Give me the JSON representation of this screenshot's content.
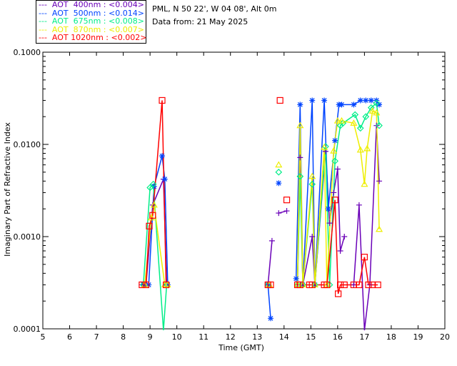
{
  "header": {
    "location": "PML, N 50 22', W 04 08', Alt 0m",
    "date": "Data from: 21 May 2025"
  },
  "legend": [
    {
      "label": "---  AOT  400nm : <0.004>",
      "color": "#6a00b8"
    },
    {
      "label": "---  AOT  500nm : <0.014>",
      "color": "#0044ff"
    },
    {
      "label": "---  AOT  675nm : <0.008>",
      "color": "#00ee88"
    },
    {
      "label": "---  AOT  870nm : <0.007>",
      "color": "#eeee00"
    },
    {
      "label": "---  AOT 1020nm : <0.002>",
      "color": "#ff0000"
    }
  ],
  "chart_data": {
    "type": "line",
    "xlabel": "Time (GMT)",
    "ylabel": "Imaginary Part of Refractive Index",
    "xlim": [
      5,
      20
    ],
    "ylim": [
      0.0001,
      0.1
    ],
    "yscale": "log",
    "grid": false,
    "legend_position": "top-left-outside",
    "xticks": [
      "5",
      "6",
      "7",
      "8",
      "9",
      "10",
      "11",
      "12",
      "13",
      "14",
      "15",
      "16",
      "17",
      "18",
      "19",
      "20"
    ],
    "yticks": [
      "0.0001",
      "0.0010",
      "0.0100",
      "0.1000"
    ],
    "series": [
      {
        "name": "AOT 400nm",
        "marker": "plus",
        "color": "#6a00b8",
        "points": [
          [
            8.7,
            0.0003
          ],
          [
            8.85,
            0.0003
          ],
          [
            9.1,
            0.0022
          ],
          [
            9.5,
            0.0042
          ],
          [
            9.62,
            0.0003
          ],
          [
            null,
            null
          ],
          [
            13.4,
            0.0003
          ],
          [
            13.55,
            0.0009
          ],
          [
            null,
            null
          ],
          [
            13.8,
            0.0018
          ],
          [
            14.1,
            0.0019
          ],
          [
            null,
            null
          ],
          [
            14.5,
            0.0003
          ],
          [
            14.6,
            0.0072
          ],
          [
            14.7,
            0.0003
          ],
          [
            15.05,
            0.001
          ],
          [
            15.15,
            0.0003
          ],
          [
            15.55,
            0.0084
          ],
          [
            15.7,
            0.0014
          ],
          [
            15.85,
            0.003
          ],
          [
            16.0,
            0.0054
          ],
          [
            16.1,
            0.0007
          ],
          [
            16.25,
            0.001
          ],
          [
            null,
            null
          ],
          [
            16.6,
            0.0003
          ],
          [
            16.8,
            0.0022
          ],
          [
            17.0,
            9e-05
          ],
          [
            17.2,
            0.0003
          ],
          [
            17.45,
            0.016
          ],
          [
            17.55,
            0.004
          ]
        ]
      },
      {
        "name": "AOT 500nm",
        "marker": "asterisk",
        "color": "#0044ff",
        "points": [
          [
            8.75,
            0.0003
          ],
          [
            8.95,
            0.0003
          ],
          [
            9.15,
            0.0035
          ],
          [
            9.45,
            0.0075
          ],
          [
            9.55,
            0.0042
          ],
          [
            9.66,
            0.0003
          ],
          [
            null,
            null
          ],
          [
            13.4,
            0.0003
          ],
          [
            13.5,
            0.00013
          ],
          [
            null,
            null
          ],
          [
            13.8,
            0.0038
          ],
          [
            null,
            null
          ],
          [
            14.45,
            0.00035
          ],
          [
            14.6,
            0.027
          ],
          [
            14.7,
            0.0003
          ],
          [
            15.05,
            0.03
          ],
          [
            15.15,
            0.0003
          ],
          [
            15.5,
            0.03
          ],
          [
            15.65,
            0.002
          ],
          [
            15.9,
            0.011
          ],
          [
            16.05,
            0.027
          ],
          [
            16.15,
            0.027
          ],
          [
            16.6,
            0.027
          ],
          [
            16.85,
            0.03
          ],
          [
            17.05,
            0.03
          ],
          [
            17.25,
            0.03
          ],
          [
            17.45,
            0.03
          ],
          [
            17.55,
            0.027
          ]
        ]
      },
      {
        "name": "AOT 675nm",
        "marker": "diamond",
        "color": "#00ee88",
        "points": [
          [
            8.75,
            0.0003
          ],
          [
            9.0,
            0.0034
          ],
          [
            9.12,
            0.0037
          ],
          [
            9.5,
            8e-05
          ],
          [
            9.62,
            0.0003
          ],
          [
            null,
            null
          ],
          [
            13.4,
            0.0003
          ],
          [
            null,
            null
          ],
          [
            13.8,
            0.005
          ],
          [
            null,
            null
          ],
          [
            14.5,
            0.0003
          ],
          [
            14.6,
            0.0045
          ],
          [
            14.7,
            0.0003
          ],
          [
            15.05,
            0.0037
          ],
          [
            15.15,
            0.0003
          ],
          [
            15.55,
            0.0095
          ],
          [
            15.7,
            0.0003
          ],
          [
            15.9,
            0.0066
          ],
          [
            16.1,
            0.016
          ],
          [
            16.2,
            0.017
          ],
          [
            16.65,
            0.021
          ],
          [
            16.85,
            0.015
          ],
          [
            17.05,
            0.02
          ],
          [
            17.25,
            0.025
          ],
          [
            17.45,
            0.028
          ],
          [
            17.55,
            0.016
          ]
        ]
      },
      {
        "name": "AOT 870nm",
        "marker": "triangle",
        "color": "#eeee00",
        "points": [
          [
            8.8,
            0.0003
          ],
          [
            9.05,
            0.0016
          ],
          [
            9.15,
            0.0022
          ],
          [
            9.55,
            0.0003
          ],
          [
            9.65,
            0.0003
          ],
          [
            null,
            null
          ],
          [
            13.45,
            0.0003
          ],
          [
            null,
            null
          ],
          [
            13.8,
            0.006
          ],
          [
            null,
            null
          ],
          [
            14.5,
            0.0003
          ],
          [
            14.6,
            0.016
          ],
          [
            14.7,
            0.0003
          ],
          [
            15.05,
            0.0045
          ],
          [
            15.15,
            0.0003
          ],
          [
            15.5,
            0.0093
          ],
          [
            15.6,
            0.0003
          ],
          [
            15.85,
            0.0085
          ],
          [
            16.0,
            0.018
          ],
          [
            16.15,
            0.018
          ],
          [
            16.6,
            0.017
          ],
          [
            16.85,
            0.0087
          ],
          [
            17.0,
            0.0037
          ],
          [
            17.1,
            0.009
          ],
          [
            17.3,
            0.023
          ],
          [
            17.45,
            0.022
          ],
          [
            17.55,
            0.0012
          ]
        ]
      },
      {
        "name": "AOT 1020nm",
        "marker": "square",
        "color": "#ff0000",
        "points": [
          [
            8.7,
            0.0003
          ],
          [
            8.85,
            0.0003
          ],
          [
            8.97,
            0.0013
          ],
          [
            9.1,
            0.0017
          ],
          [
            9.45,
            0.03
          ],
          [
            9.6,
            0.0003
          ],
          [
            null,
            null
          ],
          [
            13.4,
            0.0003
          ],
          [
            13.5,
            0.0003
          ],
          [
            null,
            null
          ],
          [
            13.85,
            0.03
          ],
          [
            null,
            null
          ],
          [
            14.1,
            0.0025
          ],
          [
            null,
            null
          ],
          [
            14.5,
            0.0003
          ],
          [
            14.6,
            0.0003
          ],
          [
            14.95,
            0.0003
          ],
          [
            15.05,
            0.0003
          ],
          [
            15.5,
            0.0003
          ],
          [
            15.6,
            0.0003
          ],
          [
            15.9,
            0.0025
          ],
          [
            16.02,
            0.00024
          ],
          [
            16.1,
            0.0003
          ],
          [
            16.25,
            0.0003
          ],
          [
            16.6,
            0.0003
          ],
          [
            16.8,
            0.0003
          ],
          [
            17.0,
            0.0006
          ],
          [
            17.15,
            0.0003
          ],
          [
            17.3,
            0.0003
          ],
          [
            17.5,
            0.0003
          ]
        ]
      }
    ]
  }
}
